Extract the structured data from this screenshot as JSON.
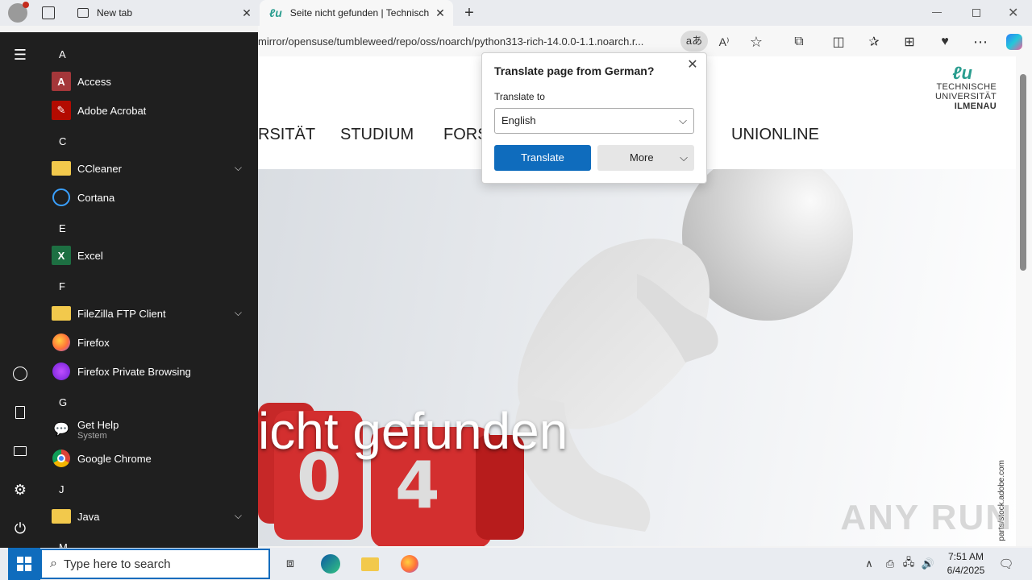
{
  "browser": {
    "tabs": [
      {
        "title": "New tab"
      },
      {
        "title": "Seite nicht gefunden | Technisch"
      }
    ],
    "url": "mirror/opensuse/tumbleweed/repo/oss/noarch/python313-rich-14.0.0-1.1.noarch.r..."
  },
  "page": {
    "logo": {
      "line1": "TECHNISCHE UNIVERSITÄT",
      "line2": "ILMENAU"
    },
    "nav": [
      "RSITÄT",
      "STUDIUM",
      "FORS",
      "UNIONLINE"
    ],
    "hero_text": "icht gefunden",
    "credit": "parts/stock.adobe.com",
    "watermark": "ANY RUN"
  },
  "translate_popup": {
    "title": "Translate page from German?",
    "label": "Translate to",
    "selected_language": "English",
    "translate_button": "Translate",
    "more_button": "More"
  },
  "start_menu": {
    "sections": [
      {
        "letter": "A",
        "apps": [
          {
            "label": "Access",
            "icon": "access-icon"
          },
          {
            "label": "Adobe Acrobat",
            "icon": "acrobat-icon"
          }
        ]
      },
      {
        "letter": "C",
        "apps": [
          {
            "label": "CCleaner",
            "icon": "folder-icon",
            "expandable": true
          },
          {
            "label": "Cortana",
            "icon": "cortana-icon"
          }
        ]
      },
      {
        "letter": "E",
        "apps": [
          {
            "label": "Excel",
            "icon": "excel-icon"
          }
        ]
      },
      {
        "letter": "F",
        "apps": [
          {
            "label": "FileZilla FTP Client",
            "icon": "folder-icon",
            "expandable": true
          },
          {
            "label": "Firefox",
            "icon": "firefox-icon"
          },
          {
            "label": "Firefox Private Browsing",
            "icon": "firefox-private-icon"
          }
        ]
      },
      {
        "letter": "G",
        "apps": [
          {
            "label": "Get Help",
            "sub": "System",
            "icon": "get-help-icon"
          },
          {
            "label": "Google Chrome",
            "icon": "chrome-icon"
          }
        ]
      },
      {
        "letter": "J",
        "apps": [
          {
            "label": "Java",
            "icon": "folder-icon",
            "expandable": true
          }
        ]
      },
      {
        "letter": "M",
        "apps": []
      }
    ]
  },
  "taskbar": {
    "search_placeholder": "Type here to search",
    "time": "7:51 AM",
    "date": "6/4/2025"
  },
  "colors": {
    "accent": "#0f6cbd",
    "start_bg": "#1f1f1f"
  }
}
